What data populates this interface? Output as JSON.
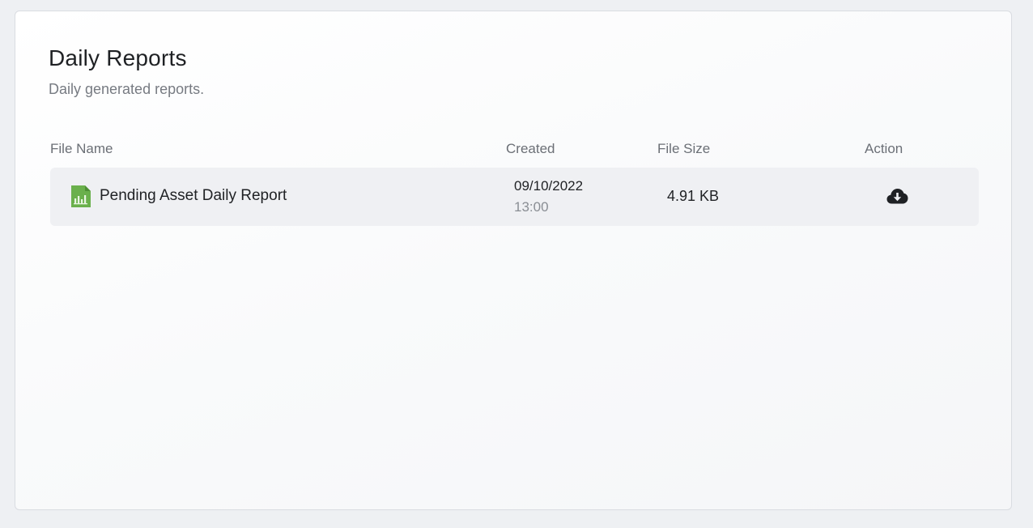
{
  "header": {
    "title": "Daily Reports",
    "subtitle": "Daily generated reports."
  },
  "table": {
    "columns": {
      "file_name": "File Name",
      "created": "Created",
      "file_size": "File Size",
      "action": "Action"
    },
    "rows": [
      {
        "icon": "spreadsheet-file-icon",
        "file_name": "Pending Asset Daily Report",
        "created_date": "09/10/2022",
        "created_time": "13:00",
        "file_size": "4.91 KB",
        "action_icon": "cloud-download-icon"
      }
    ]
  },
  "colors": {
    "file_icon": "#6ab04c",
    "row_background": "#eff0f3",
    "text_primary": "#1f2124",
    "text_secondary": "#777b82"
  }
}
